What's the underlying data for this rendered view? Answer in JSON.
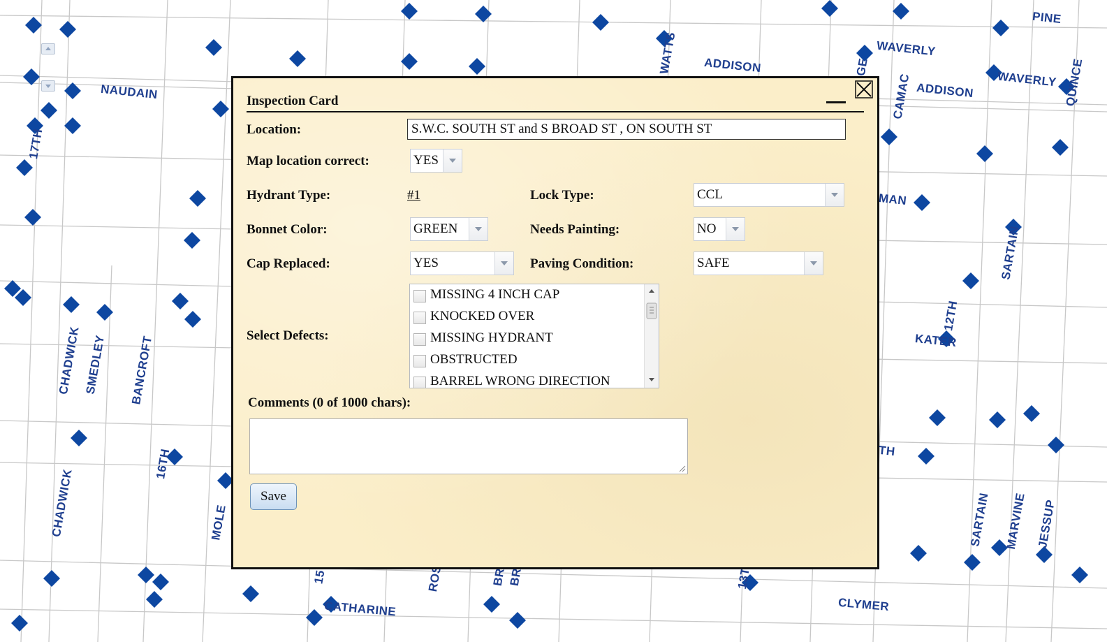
{
  "map": {
    "street_labels": [
      {
        "text": "PINE"
      },
      {
        "text": "WAVERLY"
      },
      {
        "text": "ADDISON"
      },
      {
        "text": "ADDISON"
      },
      {
        "text": "WAVERLY"
      },
      {
        "text": "QUINCE"
      },
      {
        "text": "CAMAC"
      },
      {
        "text": "GE"
      },
      {
        "text": "WATTS"
      },
      {
        "text": "NAUDAIN"
      },
      {
        "text": "17TH"
      },
      {
        "text": "MAN"
      },
      {
        "text": "SARTAIN"
      },
      {
        "text": "12TH"
      },
      {
        "text": "KATER"
      },
      {
        "text": "TH"
      },
      {
        "text": "CHADWICK"
      },
      {
        "text": "SMEDLEY"
      },
      {
        "text": "BANCROFT"
      },
      {
        "text": "CHADWICK"
      },
      {
        "text": "16TH"
      },
      {
        "text": "MOLE"
      },
      {
        "text": "15"
      },
      {
        "text": "ROS"
      },
      {
        "text": "BR"
      },
      {
        "text": "BR"
      },
      {
        "text": "13T"
      },
      {
        "text": "CATHARINE"
      },
      {
        "text": "CLYMER"
      },
      {
        "text": "SARTAIN"
      },
      {
        "text": "MARVINE"
      },
      {
        "text": "JESSUP"
      }
    ],
    "marker_color": "#0d47a1",
    "label_color": "#1f3f8f"
  },
  "dialog": {
    "title": "Inspection Card",
    "location_label": "Location:",
    "location_value": "S.W.C. SOUTH ST and S BROAD ST , ON SOUTH ST",
    "map_correct_label": "Map location correct:",
    "map_correct_value": "YES",
    "hydrant_type_label": "Hydrant Type:",
    "hydrant_type_value": "#1",
    "lock_type_label": "Lock Type:",
    "lock_type_value": "CCL",
    "bonnet_color_label": "Bonnet Color:",
    "bonnet_color_value": "GREEN",
    "needs_painting_label": "Needs Painting:",
    "needs_painting_value": "NO",
    "cap_replaced_label": "Cap Replaced:",
    "cap_replaced_value": "YES",
    "paving_condition_label": "Paving Condition:",
    "paving_condition_value": "SAFE",
    "defects_label": "Select Defects:",
    "defects": [
      {
        "label": "MISSING 4 INCH CAP",
        "checked": false
      },
      {
        "label": "KNOCKED OVER",
        "checked": false
      },
      {
        "label": "MISSING HYDRANT",
        "checked": false
      },
      {
        "label": "OBSTRUCTED",
        "checked": false
      },
      {
        "label": "BARREL WRONG DIRECTION",
        "checked": false
      }
    ],
    "comments_label": "Comments (0 of 1000 chars):",
    "comments_value": "",
    "save_label": "Save",
    "background_color": "#fbeec9"
  }
}
